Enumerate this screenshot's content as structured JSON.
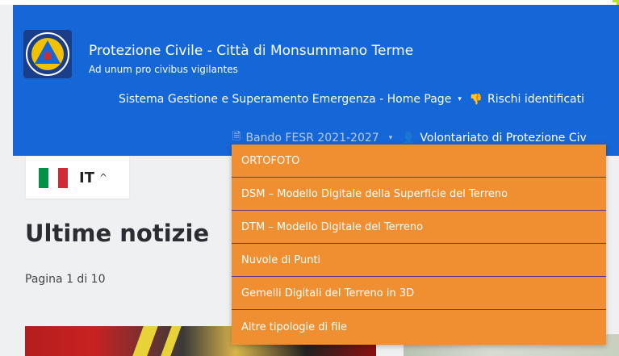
{
  "header": {
    "title": "Protezione Civile - Città di Monsummano Terme",
    "subtitle": "Ad unum pro civibus vigilantes",
    "logo_icon": "civil-protection-logo",
    "background": "#1566d6"
  },
  "nav_primary": {
    "home": "Sistema Gestione e Superamento Emergenza - Home Page",
    "home_caret": "▾",
    "rischi_icon": "thumbs-down-icon",
    "rischi": "Rischi identificati"
  },
  "nav_secondary": {
    "bando_icon": "document-icon",
    "bando": "Bando FESR 2021-2027",
    "bando_caret": "▾",
    "volontariato_icon": "user-icon",
    "volontariato": "Volontariato di Protezione Civ"
  },
  "language": {
    "code": "IT",
    "chevron": "^",
    "flag_colors": [
      "#009246",
      "#ffffff",
      "#ce2b37"
    ]
  },
  "news": {
    "title": "Ultime notizie",
    "pagination": "Pagina 1 di 10"
  },
  "dropdown": {
    "background": "#f08f32",
    "items": [
      "ORTOFOTO",
      "DSM – Modello Digitale della Superficie del Terreno",
      "DTM – Modello Digitale del Terreno",
      "Nuvole di Punti",
      "Gemelli Digitali del Terreno in 3D",
      "Altre tipologie di file"
    ]
  }
}
